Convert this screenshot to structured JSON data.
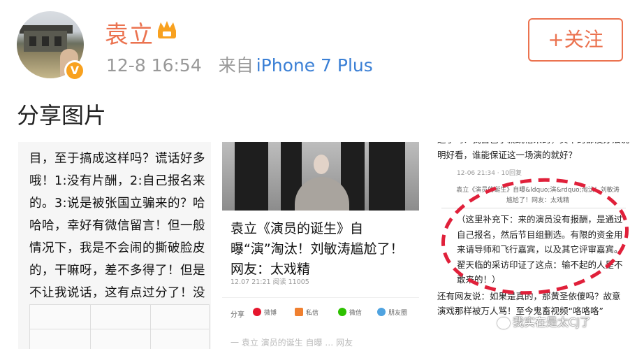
{
  "post": {
    "author": "袁立",
    "timestamp": "12-8 16:54",
    "source_prefix": "来自",
    "source": "iPhone 7 Plus",
    "follow_label": "+关注",
    "text": "分享图片"
  },
  "image1": {
    "text": "了，不让我说话了，一个娱乐节目，至于搞成这样吗？谎话好多哦！1:没有片酬，2:自己报名来的。3:说是被张国立骗来的？哈哈哈，幸好有微信留言！但一般情况下，我是不会闹的撕破脸皮的，干嘛呀，差不多得了！但是不让我说话，这有点过分了！没收了我的发送键！你们这是要通天啊！有点无法无天了！"
  },
  "image2": {
    "title": "袁立《演员的诞生》自曝“演”淘汰！刘敏涛尴尬了！网友：太戏精",
    "date": "12.07 21:21  阅读 11005",
    "share_label": "分享",
    "share_buttons": [
      "微博",
      "私信",
      "微信",
      "朋友圈"
    ],
    "bottom_text": "一 袁立 演员的诞生 自曝 … 网友"
  },
  "image3": {
    "top_text": "过了吗？我自己了就跳槽来的，其甲的都没办法说明好看，谁能保证这一场演的就好？",
    "date": "12-06 21:34  ·  10回复",
    "link_text": "袁立《演员的诞生》自曝&ldquo;演&rdquo;淘汰！刘敏涛尴尬了！网友：太戏精",
    "body": "（这里补充下：来的演员没有报酬，是通过自己报名，然后节目组删选。有限的资金用来请导师和飞行嘉宾，以及其它评审嘉宾。翟天临的采访印证了这点：输不起的人是不敢来的！）",
    "more_text": "还有网友说：如果是真的，那黄圣依傻吗？故意演戏那样被万人骂！至今鬼畜视频“咯咯咯”"
  },
  "watermark": "我实在是太CJ了",
  "colors": {
    "accent": "#eb7350",
    "link": "#3a7fd5",
    "badge": "#f8a11f",
    "ellipse": "#e0203a"
  },
  "icons": {
    "verify_badge": "verified-v-icon",
    "vip": "crown-icon",
    "watermark": "wechat-icon"
  }
}
